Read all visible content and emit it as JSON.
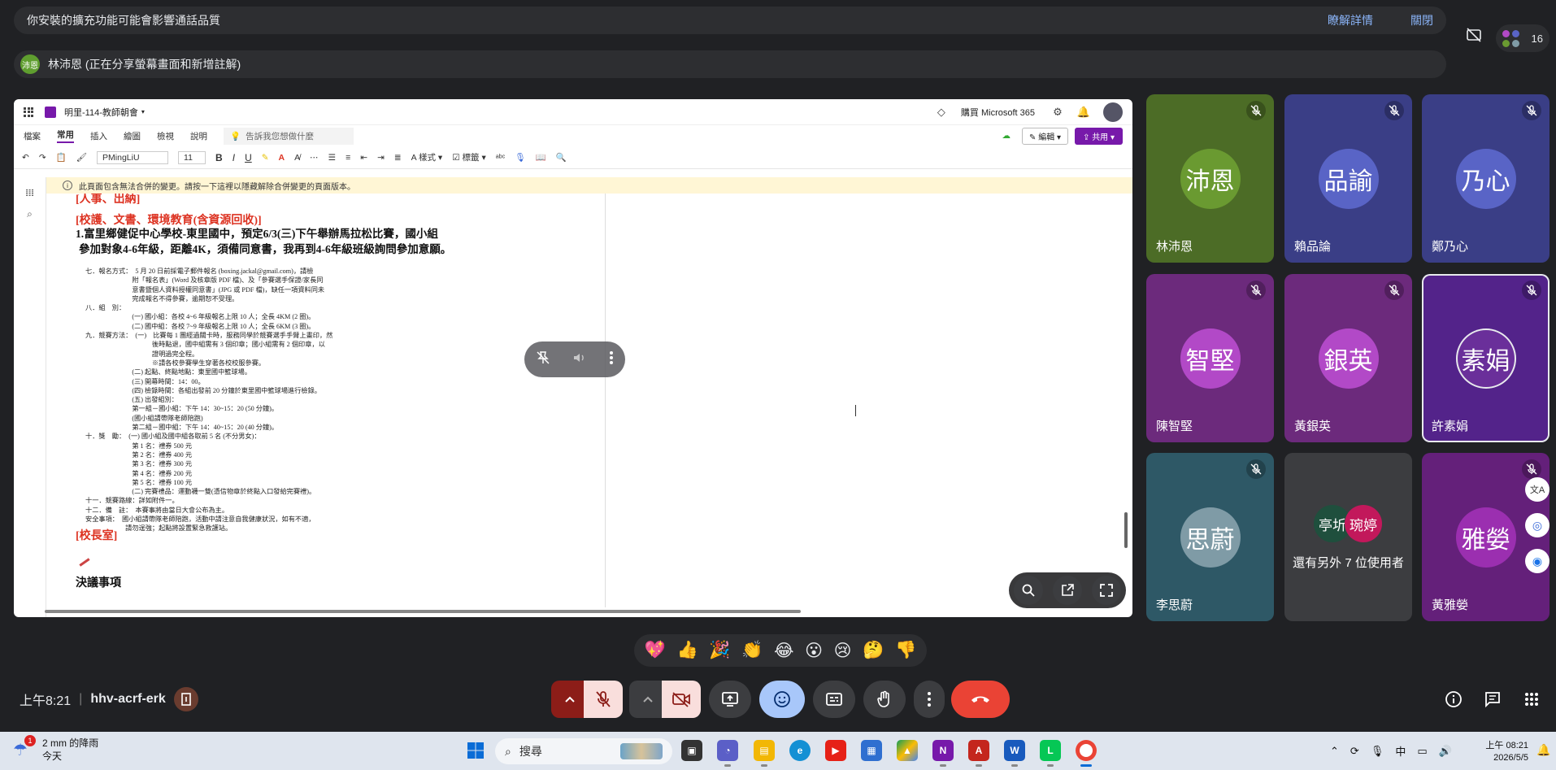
{
  "banner": {
    "warning_text": "你安裝的擴充功能可能會影響通話品質",
    "details_link": "瞭解詳情",
    "close_link": "關閉"
  },
  "presenter": {
    "avatar_text": "沛恩",
    "label": "林沛恩 (正在分享螢幕畫面和新增註解)"
  },
  "top_right": {
    "participant_count": "16"
  },
  "onenote": {
    "notebook_title": "明里-114-教師朝會",
    "buy_m365": "購買 Microsoft 365",
    "tabs": [
      "檔案",
      "常用",
      "插入",
      "繪圖",
      "檢視",
      "說明"
    ],
    "active_tab": "常用",
    "tell_me_placeholder": "告訴我您想做什麼",
    "edit_label": "編輯",
    "share_label": "共用",
    "font_name": "PMingLiU",
    "font_size": "11",
    "styles_label": "樣式",
    "tags_label": "標籤",
    "merge_notice": "此頁面包含無法合併的變更。請按一下這裡以隱藏解除合併變更的頁面版本。"
  },
  "page": {
    "section_personnel": "[人事、出納]",
    "section_school": "[校護、文書、環境教育(含資源回收)]",
    "item1_line1": "1.富里鄉健促中心學校-東里國中，預定6/3(三)下午舉辦馬拉松比賽，國小組",
    "item1_line2": "參加對象4-6年級，距離4K，須備同意書，我再到4-6年級班級詢問參加意願。",
    "scan_lines": [
      "七．報名方式：　5 月 20 日前採電子郵件報名 (boxing.jackal@gmail.com)，請檢",
      "　　　　　　　附「報名表」(Word 及核章版 PDF 檔)、及「參賽選手保證/家長同",
      "　　　　　　　意書暨個人資料授權同意書」(JPG 或 PDF 檔)，缺任一項資料同未",
      "　　　　　　　完成報名不得參賽，逾期恕不受理。",
      "八．組　別：",
      "　　　　　　　(一) 國小組：各校 4~6 年級報名上限 10 人；全長 4KM (2 圈)。",
      "　　　　　　　(二) 國中組：各校 7~9 年級報名上限 10 人；全長 6KM (3 圈)。",
      "九．競賽方法：　(一)　比賽每 1 團經過關卡時，服務同學於競賽選手手臂上畫印，然",
      "　　　　　　　　　　後時點退，國中組需有 3 個印章；國小組需有 2 個印章，以",
      "　　　　　　　　　　證明過完全程。",
      "　　　　　　　　　　※請各校參賽學生穿著各校校服參賽。",
      "　　　　　　　(二) 起點、終點地點：東里國中籃球場。",
      "　　　　　　　(三) 開幕時間：14：00。",
      "　　　　　　　(四) 檢錄時間：各組出發前 20 分鐘於東里國中籃球場進行檢錄。",
      "　　　　　　　(五) 出發組別：",
      "　　　　　　　第一組－國小組：下午 14：30~15：20 (50 分鐘)。",
      "　　　　　　　(國小組請帶隊老師陪跑)",
      "　　　　　　　第二組－國中組：下午 14：40~15：20 (40 分鐘)。",
      "十．獎　勵：　(一) 國小組及國中組各取前 5 名 (不分男女)：",
      "　　　　　　　第 1 名：禮券 500 元",
      "　　　　　　　第 2 名：禮券 400 元",
      "　　　　　　　第 3 名：禮券 300 元",
      "　　　　　　　第 4 名：禮券 200 元",
      "　　　　　　　第 5 名：禮券 100 元",
      "　　　　　　　(二) 完賽禮品：運動襪一雙(憑信物章於終點入口發給完賽禮)。",
      "十一．競賽路線：詳如附件一。",
      "十二．備　註：　本賽事將由當日大會公布為主。",
      "安全事項：　國小組請帶隊老師陪跑，活動中請注意自我健康狀況，如有不適，",
      "　　　　　　請勿逞強；起點將設置緊急救護站。"
    ],
    "section_principal": "[校長室]",
    "decisions": "決議事項"
  },
  "participants": [
    {
      "avatar": "沛恩",
      "name": "林沛恩",
      "avatar_color": "#6a9a31",
      "tile_color": "#4c6c26"
    },
    {
      "avatar": "品諭",
      "name": "賴品論",
      "avatar_color": "#5964c6",
      "tile_color": "#3a3e86"
    },
    {
      "avatar": "乃心",
      "name": "鄭乃心",
      "avatar_color": "#5964c6",
      "tile_color": "#3a3e86"
    },
    {
      "avatar": "智堅",
      "name": "陳智堅",
      "avatar_color": "#b249c7",
      "tile_color": "#6c2a7c"
    },
    {
      "avatar": "銀英",
      "name": "黃銀英",
      "avatar_color": "#b249c7",
      "tile_color": "#6c2a7c"
    },
    {
      "avatar": "素娟",
      "name": "許素娟",
      "avatar_color": "#6a2f9a",
      "tile_color": "#53238a"
    },
    {
      "avatar": "思蔚",
      "name": "李思蔚",
      "avatar_color": "#7f9ba6",
      "tile_color": "#2e5866"
    },
    {
      "avatar": "雅嫈",
      "name": "黃雅嫈",
      "avatar_color": "#9b2fb0",
      "tile_color": "#64207a"
    }
  ],
  "more_tile": {
    "avatar1": "亭圻",
    "avatar1_color": "#1f4f3d",
    "avatar2": "琬婷",
    "avatar2_color": "#c2185b",
    "label": "還有另外 7 位使用者"
  },
  "reactions": [
    "💖",
    "👍",
    "🎉",
    "👏",
    "😂",
    "😮",
    "😢",
    "🤔",
    "👎"
  ],
  "meeting": {
    "time": "上午8:21",
    "code": "hhv-acrf-erk"
  },
  "taskbar": {
    "weather_badge": "1",
    "weather_line1": "2 mm 的降雨",
    "weather_line2": "今天",
    "search_placeholder": "搜尋",
    "ime_label": "中",
    "clock_time": "上午 08:21",
    "clock_date": "2026/5/5"
  }
}
